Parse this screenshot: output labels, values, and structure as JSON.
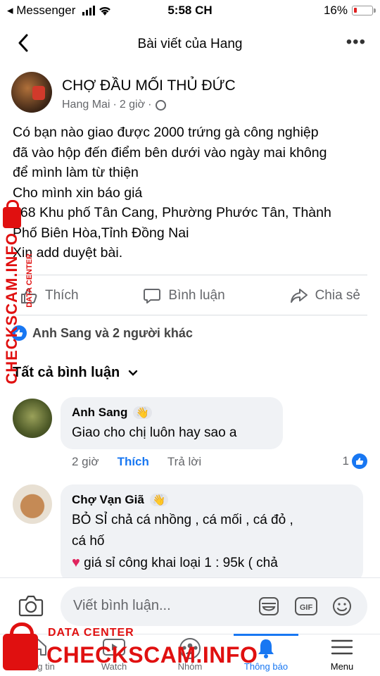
{
  "status_bar": {
    "back_app": "◂ Messenger",
    "time": "5:58 CH",
    "battery": "16%",
    "battery_level": 0.16
  },
  "header": {
    "title": "Bài viết của Hang"
  },
  "post": {
    "group_name": "CHỢ ĐẦU MỐI THỦ ĐỨC",
    "author": "Hang Mai",
    "time": "2 giờ",
    "separator": "·",
    "lines": [
      "Có bạn nào giao được 2000 trứng gà công nghiệp",
      "đã vào hộp đến điểm bên dưới vào ngày mai không",
      "để mình làm từ thiện",
      "Cho mình xin báo giá",
      "568 Khu phố Tân Cang, Phường Phước Tân, Thành",
      "Phố Biên Hòa,Tỉnh Đồng Nai",
      "Xin add duyệt bài."
    ]
  },
  "actions": {
    "like": "Thích",
    "comment": "Bình luận",
    "share": "Chia sẻ"
  },
  "reactions": {
    "summary": "Anh Sang và 2 người khác"
  },
  "comments_header": "Tất cả bình luận",
  "comments": [
    {
      "name": "Anh Sang",
      "text": "Giao cho chị luôn hay sao a",
      "time": "2 giờ",
      "like": "Thích",
      "reply": "Trả lời",
      "like_count": "1"
    },
    {
      "name": "Chợ Vạn Giã",
      "lines": [
        "BỎ SỈ chả cá nhồng , cá mối , cá đỏ ,",
        "cá hố",
        "giá sỉ công khai loại 1 : 95k  ( chả"
      ]
    }
  ],
  "composer": {
    "placeholder": "Viết bình luận..."
  },
  "nav": {
    "items": [
      {
        "label": "Bảng tin",
        "icon": "home-icon"
      },
      {
        "label": "Watch",
        "icon": "watch-icon"
      },
      {
        "label": "Nhóm",
        "icon": "groups-icon"
      },
      {
        "label": "Thông báo",
        "icon": "bell-icon",
        "active": true
      },
      {
        "label": "Menu",
        "icon": "menu-icon"
      }
    ]
  },
  "watermark": {
    "vertical": "CHECKSCAM.INFO",
    "vertical_small": "DATA CENTER",
    "bottom_small": "DATA CENTER",
    "bottom_big": "CHECKSCAM.INFO"
  },
  "colors": {
    "accent": "#1877f2",
    "watermark": "#e01010"
  }
}
